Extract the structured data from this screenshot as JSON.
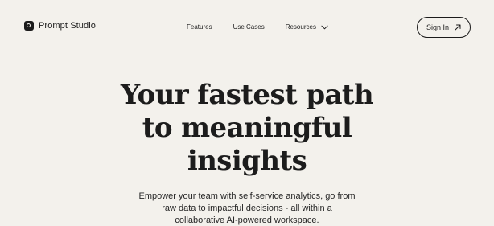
{
  "brand": {
    "name": "Prompt Studio",
    "logo_icon": "logo-mark"
  },
  "nav": {
    "items": [
      {
        "label": "Features"
      },
      {
        "label": "Use Cases"
      },
      {
        "label": "Resources",
        "icon": "chevron-down-icon"
      }
    ]
  },
  "signin": {
    "label": "Sign In",
    "icon": "arrow-up-right-icon"
  },
  "hero": {
    "title_lines": [
      "Your fastest path",
      "to meaningful",
      "insights"
    ],
    "subtitle_lines": [
      "Empower your team with self-service analytics, go from",
      "raw data to impactful decisions - all within a",
      "collaborative AI-powered workspace."
    ]
  },
  "colors": {
    "background": "#f3f1ec",
    "text": "#1c1c1c",
    "accent_dark": "#1b1b1b"
  }
}
